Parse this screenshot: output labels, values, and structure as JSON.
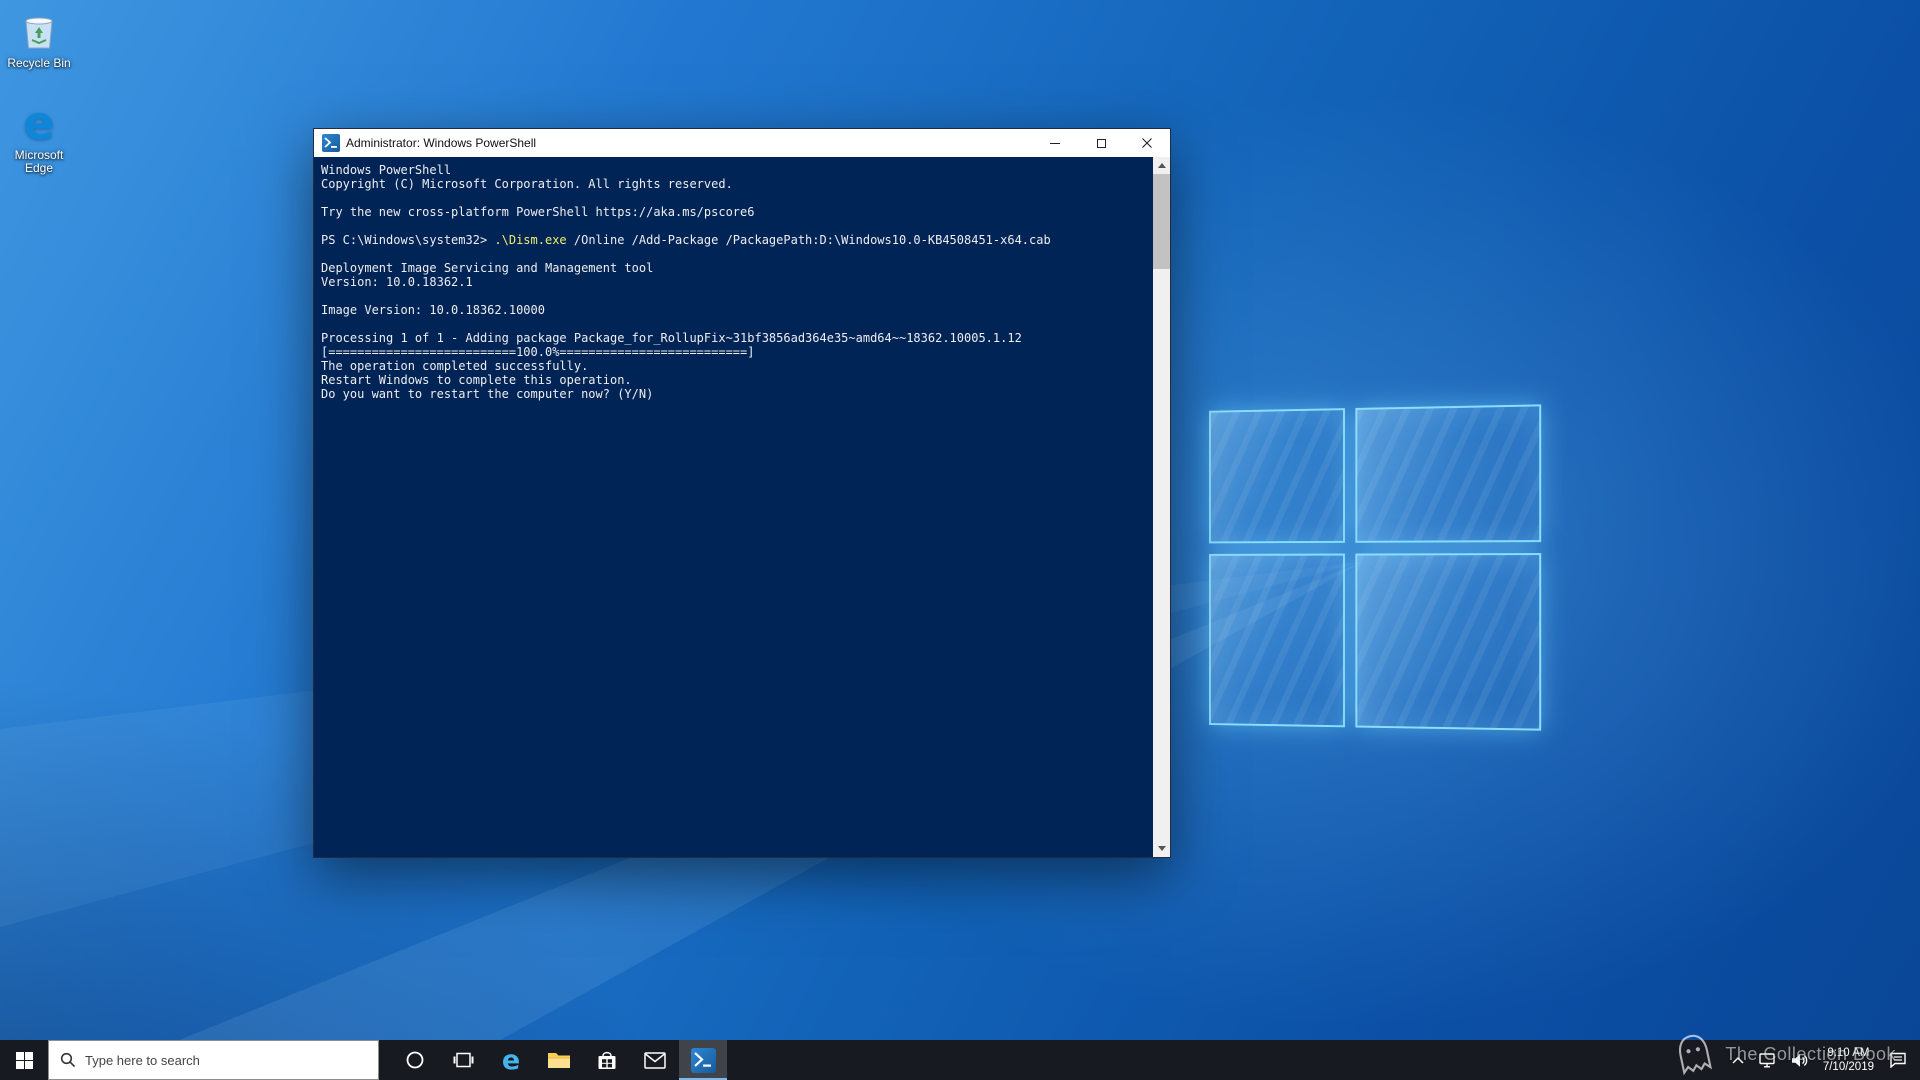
{
  "colors": {
    "console_bg": "#012456",
    "cmd_yellow": "#f0ee6e",
    "taskbar_bg": "#171a21",
    "accent_blue": "#0078d7"
  },
  "desktop": {
    "icons": [
      {
        "name": "recycle-bin",
        "label": "Recycle Bin"
      },
      {
        "name": "microsoft-edge",
        "label": "Microsoft Edge"
      }
    ]
  },
  "window": {
    "title": "Administrator: Windows PowerShell",
    "console": {
      "lines": [
        [
          {
            "t": "Windows PowerShell"
          }
        ],
        [
          {
            "t": "Copyright (C) Microsoft Corporation. All rights reserved."
          }
        ],
        [],
        [
          {
            "t": "Try the new cross-platform PowerShell https://aka.ms/pscore6"
          }
        ],
        [],
        [
          {
            "t": "PS C:\\Windows\\system32> "
          },
          {
            "t": ".\\Dism.exe",
            "c": "cmd"
          },
          {
            "t": " /Online /Add-Package /PackagePath:D:\\Windows10.0-KB4508451-x64.cab"
          }
        ],
        [],
        [
          {
            "t": "Deployment Image Servicing and Management tool"
          }
        ],
        [
          {
            "t": "Version: 10.0.18362.1"
          }
        ],
        [],
        [
          {
            "t": "Image Version: 10.0.18362.10000"
          }
        ],
        [],
        [
          {
            "t": "Processing 1 of 1 - Adding package Package_for_RollupFix~31bf3856ad364e35~amd64~~18362.10005.1.12"
          }
        ],
        [
          {
            "t": "[==========================100.0%==========================]"
          }
        ],
        [
          {
            "t": "The operation completed successfully."
          }
        ],
        [
          {
            "t": "Restart Windows to complete this operation."
          }
        ],
        [
          {
            "t": "Do you want to restart the computer now? (Y/N)"
          }
        ]
      ]
    }
  },
  "taskbar": {
    "search_placeholder": "Type here to search",
    "icon_names": [
      "start",
      "search",
      "cortana",
      "task-view",
      "edge",
      "file-explorer",
      "microsoft-store",
      "mail",
      "powershell"
    ],
    "tray_icon_names": [
      "hidden-icons-chevron",
      "network",
      "volume",
      "clock",
      "action-center"
    ],
    "clock": {
      "time": "9:10 AM",
      "date": "7/10/2019"
    }
  },
  "watermark": {
    "text": "The Collection Book"
  }
}
